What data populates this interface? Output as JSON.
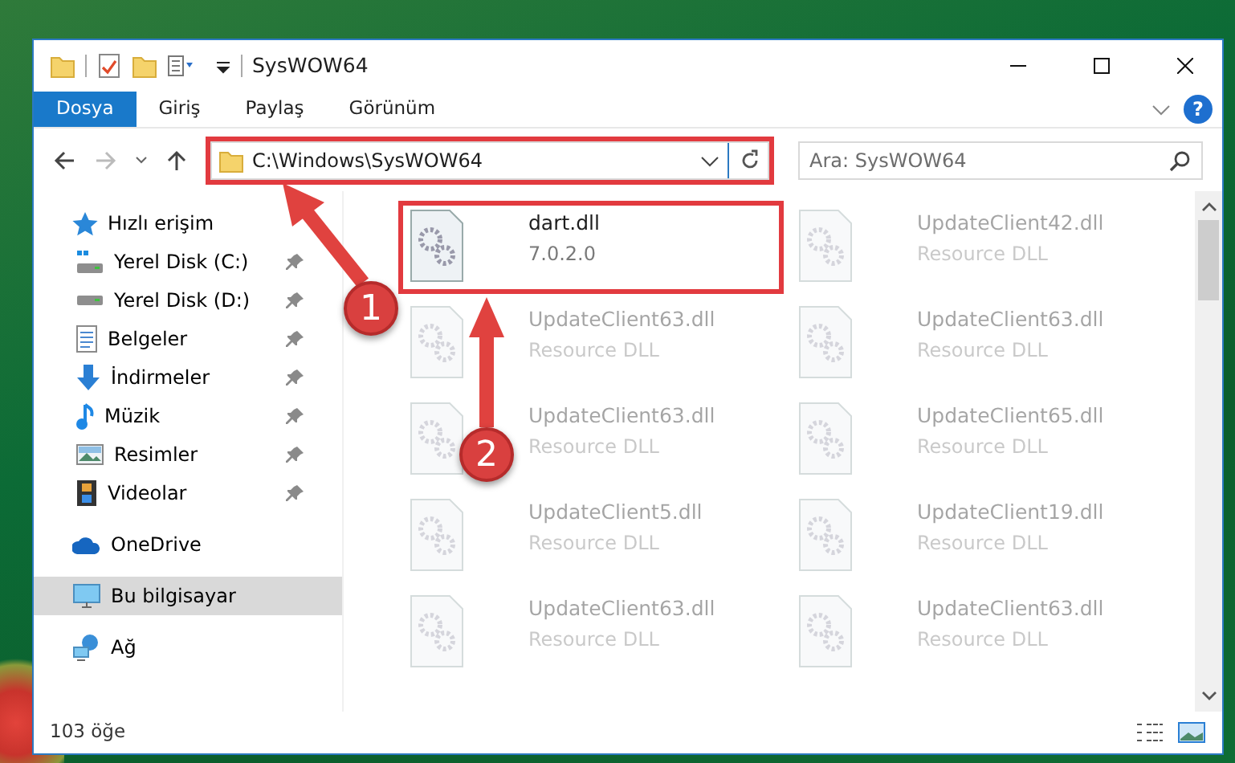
{
  "window": {
    "title": "SysWOW64"
  },
  "ribbon_tabs": [
    {
      "label": "Dosya",
      "selected": true
    },
    {
      "label": "Giriş",
      "selected": false
    },
    {
      "label": "Paylaş",
      "selected": false
    },
    {
      "label": "Görünüm",
      "selected": false
    }
  ],
  "help": {
    "glyph": "?"
  },
  "address": {
    "path": "C:\\Windows\\SysWOW64",
    "highlighted": true
  },
  "search": {
    "placeholder": "Ara: SysWOW64"
  },
  "sidebar": {
    "items": [
      {
        "label": "Hızlı erişim",
        "kind": "star",
        "selected": false,
        "children": [
          {
            "label": "Yerel Disk (C:)",
            "kind": "drive-system",
            "pinned": true,
            "selected": false
          },
          {
            "label": "Yerel Disk (D:)",
            "kind": "drive",
            "pinned": true,
            "selected": false
          },
          {
            "label": "Belgeler",
            "kind": "document",
            "pinned": true,
            "selected": false
          },
          {
            "label": "İndirmeler",
            "kind": "download",
            "pinned": true,
            "selected": false
          },
          {
            "label": "Müzik",
            "kind": "music",
            "pinned": true,
            "selected": false
          },
          {
            "label": "Resimler",
            "kind": "pictures",
            "pinned": true,
            "selected": false
          },
          {
            "label": "Videolar",
            "kind": "video",
            "pinned": true,
            "selected": false
          }
        ]
      },
      {
        "label": "OneDrive",
        "kind": "cloud",
        "selected": false
      },
      {
        "label": "Bu bilgisayar",
        "kind": "computer",
        "selected": true
      },
      {
        "label": "Ağ",
        "kind": "network",
        "selected": false
      }
    ]
  },
  "files": [
    {
      "name": "dart.dll",
      "detail": "7.0.2.0",
      "blurred": false,
      "highlighted": true
    },
    {
      "name": "UpdateClient42.dll",
      "detail": "Resource DLL",
      "blurred": true,
      "highlighted": false
    },
    {
      "name": "UpdateClient63.dll",
      "detail": "Resource DLL",
      "blurred": true,
      "highlighted": false
    },
    {
      "name": "UpdateClient63.dll",
      "detail": "Resource DLL",
      "blurred": true,
      "highlighted": false
    },
    {
      "name": "UpdateClient63.dll",
      "detail": "Resource DLL",
      "blurred": true,
      "highlighted": false
    },
    {
      "name": "UpdateClient65.dll",
      "detail": "Resource DLL",
      "blurred": true,
      "highlighted": false
    },
    {
      "name": "UpdateClient5.dll",
      "detail": "Resource DLL",
      "blurred": true,
      "highlighted": false
    },
    {
      "name": "UpdateClient19.dll",
      "detail": "Resource DLL",
      "blurred": true,
      "highlighted": false
    },
    {
      "name": "UpdateClient63.dll",
      "detail": "Resource DLL",
      "blurred": true,
      "highlighted": false
    },
    {
      "name": "UpdateClient63.dll",
      "detail": "Resource DLL",
      "blurred": true,
      "highlighted": false
    }
  ],
  "status_bar": {
    "count": "103 öğe"
  },
  "annotations": [
    {
      "label": "1"
    },
    {
      "label": "2"
    }
  ]
}
